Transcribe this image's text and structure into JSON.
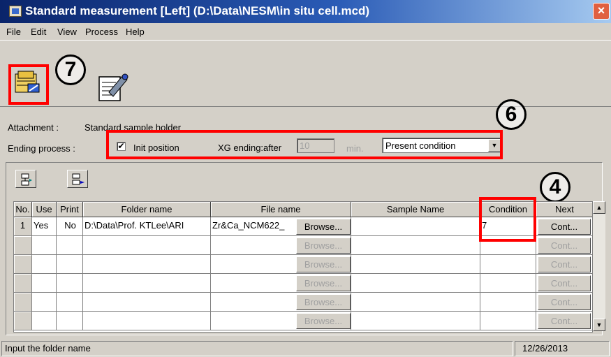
{
  "window": {
    "title": "Standard measurement [Left] (D:\\Data\\NESM\\in situ cell.mcd)",
    "close_glyph": "×"
  },
  "menu": [
    "File",
    "Edit",
    "View",
    "Process",
    "Help"
  ],
  "toolbar": {
    "buttons": [
      {
        "icon": "start-measurement-icon"
      },
      {
        "icon": "edit-condition-icon"
      }
    ]
  },
  "callouts": {
    "seven": "7",
    "six": "6",
    "four": "4",
    "color": "#ff0000"
  },
  "attachment": {
    "label": "Attachment :",
    "value": "Standard sample holder"
  },
  "ending": {
    "label": "Ending process :",
    "init_position_checked": true,
    "check_glyph": "✔",
    "init_position_label": "Init position",
    "xg_label": "XG ending:after",
    "xg_value": "10",
    "xg_unit": "min.",
    "condition_selected": "Present condition"
  },
  "table": {
    "headers": [
      "No.",
      "Use",
      "Print",
      "Folder name",
      "File name",
      "Sample Name",
      "Condition",
      "Next"
    ],
    "rows": [
      {
        "no": "1",
        "use": "Yes",
        "print": "No",
        "folder": "D:\\Data\\Prof. KTLee\\ARI",
        "file": "Zr&Ca_NCM622_",
        "browse": "Browse...",
        "sample": "",
        "condition": "7",
        "next": "Cont..."
      },
      {
        "no": "",
        "use": "",
        "print": "",
        "folder": "",
        "file": "",
        "browse": "Browse...",
        "sample": "",
        "condition": "",
        "next": "Cont..."
      },
      {
        "no": "",
        "use": "",
        "print": "",
        "folder": "",
        "file": "",
        "browse": "Browse...",
        "sample": "",
        "condition": "",
        "next": "Cont..."
      },
      {
        "no": "",
        "use": "",
        "print": "",
        "folder": "",
        "file": "",
        "browse": "Browse...",
        "sample": "",
        "condition": "",
        "next": "Cont..."
      },
      {
        "no": "",
        "use": "",
        "print": "",
        "folder": "",
        "file": "",
        "browse": "Browse...",
        "sample": "",
        "condition": "",
        "next": "Cont..."
      },
      {
        "no": "",
        "use": "",
        "print": "",
        "folder": "",
        "file": "",
        "browse": "Browse...",
        "sample": "",
        "condition": "",
        "next": "Cont..."
      }
    ]
  },
  "scroll": {
    "up": "▲",
    "down": "▼"
  },
  "status": {
    "message": "Input the folder name",
    "date": "12/26/2013"
  }
}
